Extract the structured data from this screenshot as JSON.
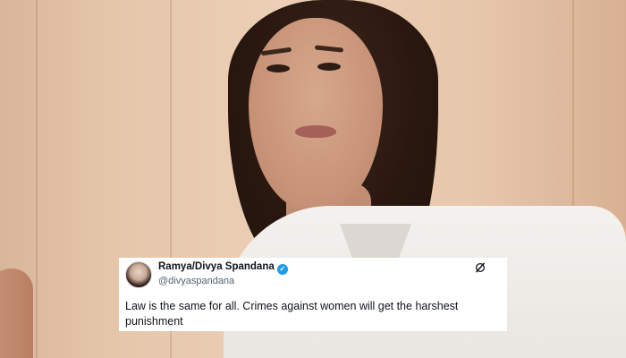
{
  "tweet": {
    "display_name": "Ramya/Divya Spandana",
    "handle": "@divyaspandana",
    "verified_mark": "✓",
    "text": "Law is the same for all. Crimes against women will get the harshest punishment",
    "verified_icon": "verified-badge-icon",
    "platform_icon": "x-logo-icon",
    "accent_color": "#1d9bf0"
  },
  "background": {
    "subject": "photo-of-woman-in-white-blazer",
    "wall_color": "#e6c6ab",
    "blazer_color": "#f4f1ee"
  }
}
